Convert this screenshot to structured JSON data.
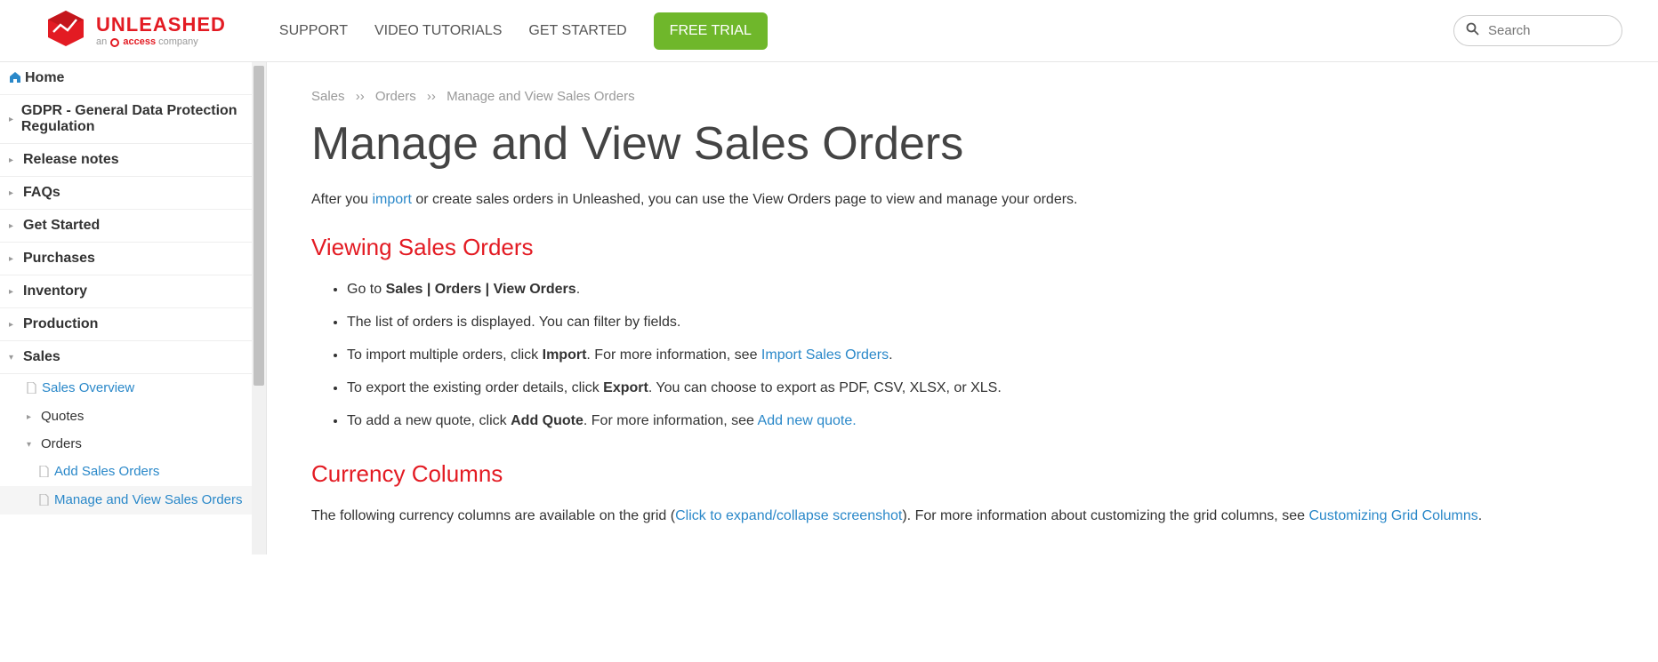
{
  "header": {
    "logo_main": "UNLEASHED",
    "logo_sub_prefix": "an ",
    "logo_sub_brand": "access",
    "logo_sub_suffix": " company",
    "nav": {
      "support": "SUPPORT",
      "videos": "VIDEO TUTORIALS",
      "get_started": "GET STARTED",
      "free_trial": "FREE TRIAL"
    },
    "search_placeholder": "Search"
  },
  "sidebar": {
    "home": "Home",
    "gdpr": "GDPR - General Data Protection Regulation",
    "release_notes": "Release notes",
    "faqs": "FAQs",
    "get_started": "Get Started",
    "purchases": "Purchases",
    "inventory": "Inventory",
    "production": "Production",
    "sales": "Sales",
    "sales_sub": {
      "overview": "Sales Overview",
      "quotes": "Quotes",
      "orders": "Orders",
      "add_sales_orders": "Add Sales Orders",
      "manage_view": "Manage and View Sales Orders"
    }
  },
  "breadcrumb": {
    "l1": "Sales",
    "l2": "Orders",
    "l3": "Manage and View Sales Orders",
    "sep": "››"
  },
  "page": {
    "title": "Manage and View Sales Orders",
    "intro_before": "After you ",
    "intro_link": "import",
    "intro_after": " or create sales orders in Unleashed, you can use the View Orders page to view and manage your orders.",
    "section1_title": "Viewing Sales Orders",
    "bullets": {
      "b1_before": "Go to ",
      "b1_bold": "Sales | Orders | View Orders",
      "b1_after": ".",
      "b2": "The list of orders is displayed. You can filter by fields.",
      "b3_before": "To import multiple orders, click ",
      "b3_bold": "Import",
      "b3_mid": ". For more information, see ",
      "b3_link": "Import Sales Orders",
      "b3_after": ".",
      "b4_before": "To export the existing order details, click ",
      "b4_bold": "Export",
      "b4_after": ". You can choose to export as PDF, CSV, XLSX, or XLS.",
      "b5_before": "To add a new quote, click ",
      "b5_bold": "Add Quote",
      "b5_mid": ". For more information, see ",
      "b5_link": "Add new quote.",
      "b5_after": ""
    },
    "section2_title": "Currency Columns",
    "currency_before": "The following currency columns are available on the grid (",
    "currency_link1": "Click to expand/collapse screenshot",
    "currency_mid": "). For more information about customizing the grid columns, see ",
    "currency_link2": "Customizing Grid Columns",
    "currency_after": "."
  }
}
